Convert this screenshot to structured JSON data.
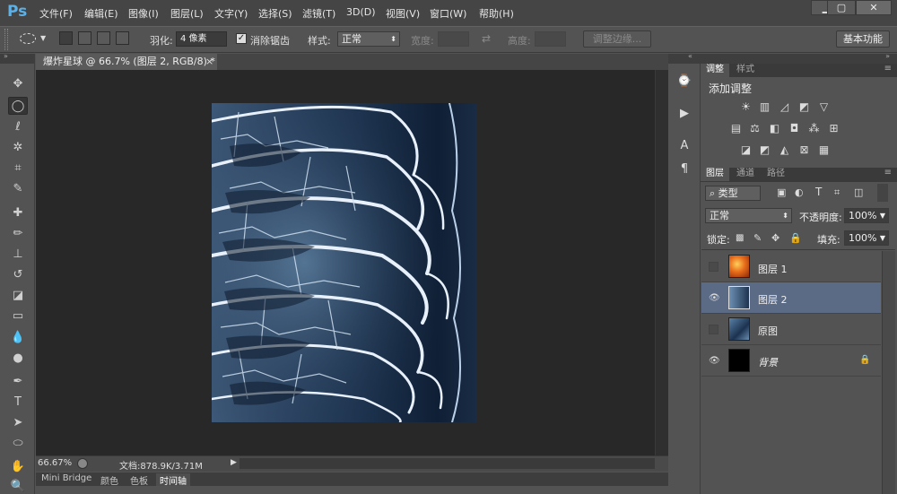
{
  "app": {
    "logo": "Ps"
  },
  "menu": [
    "文件(F)",
    "编辑(E)",
    "图像(I)",
    "图层(L)",
    "文字(Y)",
    "选择(S)",
    "滤镜(T)",
    "3D(D)",
    "视图(V)",
    "窗口(W)",
    "帮助(H)"
  ],
  "window_controls": {
    "minimize": "▁",
    "restore": "▢",
    "close": "✕"
  },
  "options": {
    "feather_label": "羽化:",
    "feather_value": "4 像素",
    "antialias_label": "消除锯齿",
    "style_label": "样式:",
    "style_value": "正常",
    "width_label": "宽度:",
    "height_label": "高度:",
    "refine_edge": "调整边缘...",
    "workspace": "基本功能"
  },
  "document": {
    "tab_title": "爆炸星球 @ 66.7% (图层 2, RGB/8) *",
    "tab_close": "×",
    "zoom": "66.67%",
    "doc_info": "文档:878.9K/3.71M"
  },
  "bottom_tabs": [
    "Mini Bridge",
    "颜色",
    "色板",
    "时间轴"
  ],
  "adjustments": {
    "tabs": [
      "调整",
      "样式"
    ],
    "title": "添加调整"
  },
  "layers": {
    "tabs": [
      "图层",
      "通道",
      "路径"
    ],
    "filter_kind": "类型",
    "blend_mode": "正常",
    "opacity_label": "不透明度:",
    "opacity_value": "100%",
    "lock_label": "锁定:",
    "fill_label": "填充:",
    "fill_value": "100%",
    "items": [
      {
        "name": "图层 1",
        "visible": false
      },
      {
        "name": "图层 2",
        "visible": true,
        "selected": true
      },
      {
        "name": "原图",
        "visible": false
      },
      {
        "name": "背景",
        "visible": true,
        "locked": true
      }
    ]
  },
  "colors": {
    "accent": "#5db1e6",
    "selected_layer": "#5b6a85",
    "canvas_bg": "#282828",
    "panel_bg": "#535353"
  }
}
